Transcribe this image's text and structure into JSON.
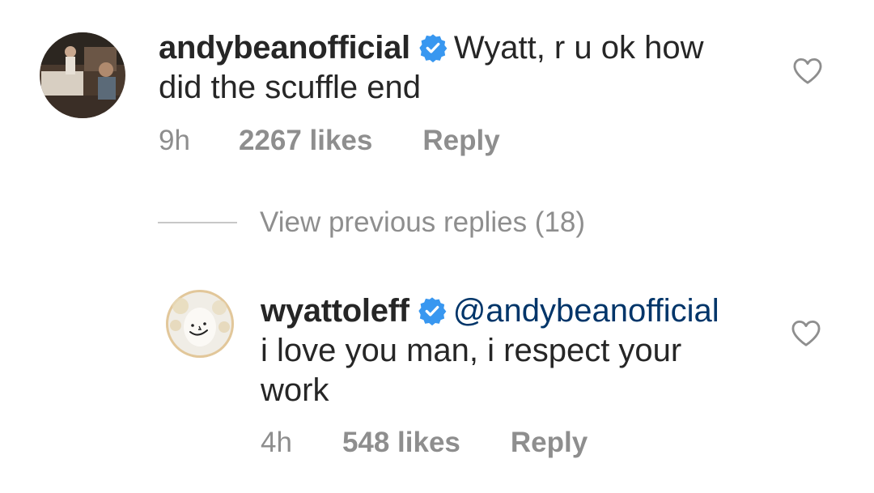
{
  "comments": [
    {
      "username": "andybeanofficial",
      "verified": true,
      "text": "Wyatt, r u ok how did the scuffle end",
      "time": "9h",
      "likes": "2267 likes",
      "reply_label": "Reply"
    }
  ],
  "view_previous_replies": "View previous replies (18)",
  "replies": [
    {
      "username": "wyattoleff",
      "verified": true,
      "mention": "@andybeanofficial",
      "text": "i love you man, i respect your work",
      "time": "4h",
      "likes": "548 likes",
      "reply_label": "Reply"
    }
  ],
  "colors": {
    "username": "#262626",
    "text": "#262626",
    "mention": "#003569",
    "meta": "#8e8e8e",
    "verified": "#3897f0",
    "divider": "#c7c7c7"
  },
  "icons": {
    "verified": "verified-badge-icon",
    "like": "heart-outline-icon"
  }
}
